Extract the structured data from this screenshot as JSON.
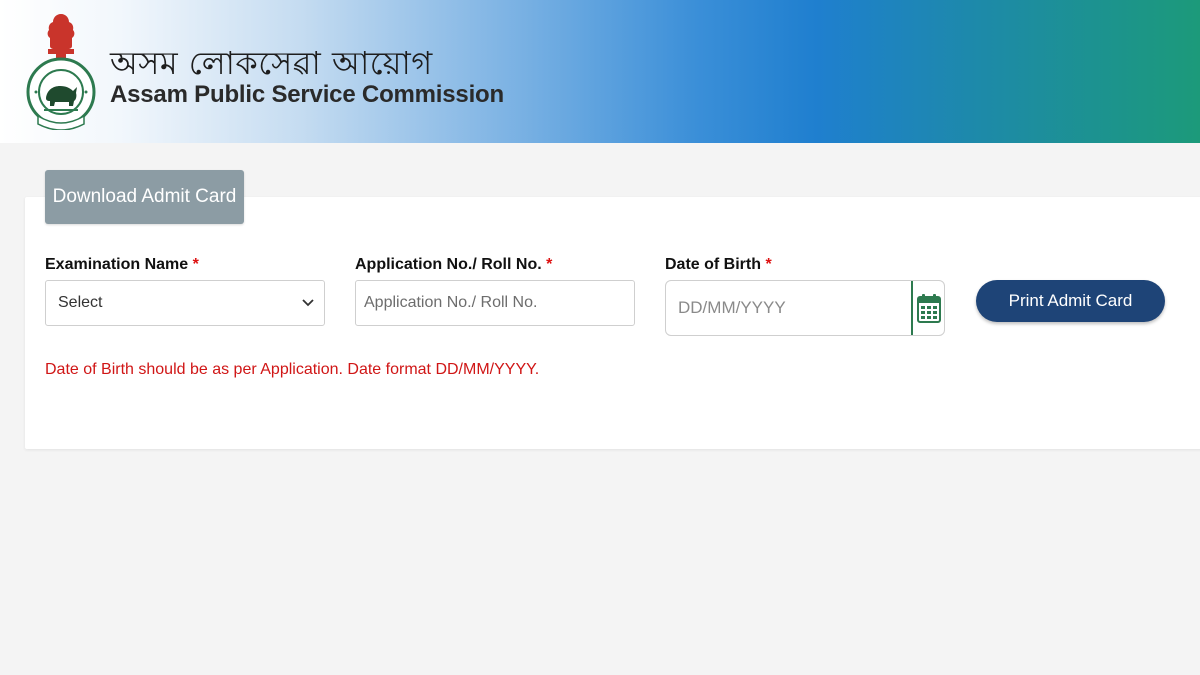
{
  "header": {
    "title_assamese": "অসম লোকসেৱা আয়োগ",
    "title_english": "Assam Public Service Commission",
    "logo_icon": "apsc-emblem-icon"
  },
  "tab": {
    "label": "Download Admit Card"
  },
  "form": {
    "exam_name": {
      "label": "Examination Name",
      "required_mark": "*",
      "selected": "Select"
    },
    "app_no": {
      "label": "Application No./ Roll No.",
      "required_mark": "*",
      "placeholder": "Application No./ Roll No."
    },
    "dob": {
      "label": "Date of Birth",
      "required_mark": "*",
      "placeholder": "DD/MM/YYYY",
      "icon": "calendar-icon"
    },
    "print_button": "Print Admit Card",
    "note": "Date of Birth should be as per Application. Date format DD/MM/YYYY."
  },
  "colors": {
    "tab_bg": "#8c9ca4",
    "print_btn_bg": "#1e4477",
    "required": "#dd1111",
    "calendar": "#2d7a4f",
    "note": "#d01616"
  }
}
